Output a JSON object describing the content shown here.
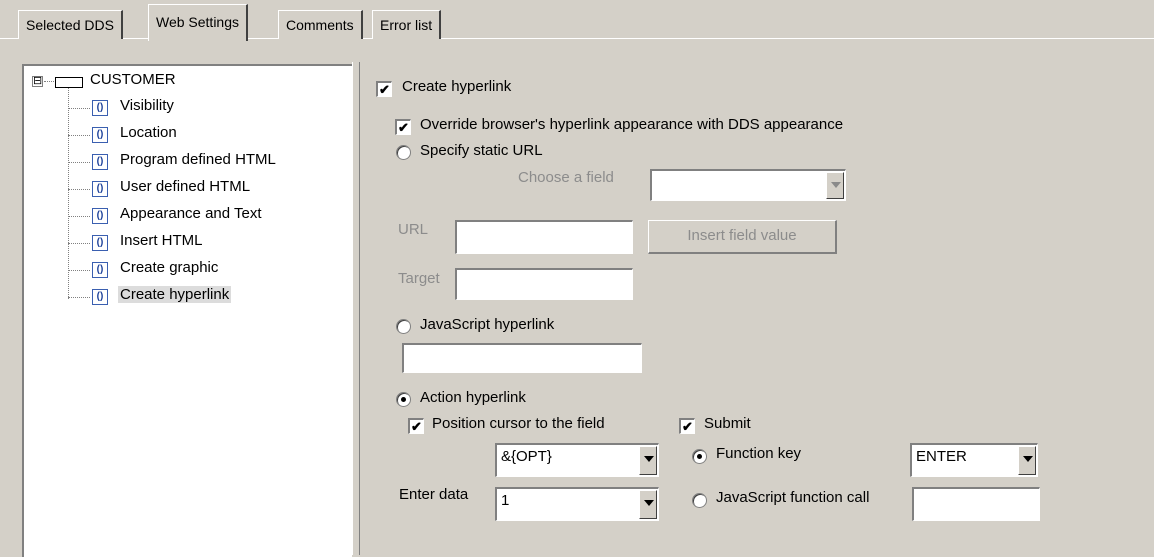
{
  "tabs": [
    {
      "label": "Selected DDS",
      "active": false
    },
    {
      "label": "Web Settings",
      "active": true
    },
    {
      "label": "Comments",
      "active": false
    },
    {
      "label": "Error list",
      "active": false
    }
  ],
  "tree": {
    "root": {
      "label": "CUSTOMER",
      "expander": "⊟",
      "icon": "record-icon"
    },
    "items": [
      {
        "label": "Visibility",
        "icon": "field-icon"
      },
      {
        "label": "Location",
        "icon": "field-icon"
      },
      {
        "label": "Program defined HTML",
        "icon": "field-icon"
      },
      {
        "label": "User defined HTML",
        "icon": "field-icon"
      },
      {
        "label": "Appearance and Text",
        "icon": "field-icon"
      },
      {
        "label": "Insert HTML",
        "icon": "field-icon"
      },
      {
        "label": "Create graphic",
        "icon": "field-icon"
      },
      {
        "label": "Create hyperlink",
        "icon": "field-icon",
        "selected": true
      }
    ]
  },
  "form": {
    "create_hyperlink": {
      "label": "Create hyperlink",
      "checked": true
    },
    "override_appearance": {
      "label": "Override browser's hyperlink appearance with DDS appearance",
      "checked": true
    },
    "static_url": {
      "label": "Specify static URL",
      "selected": false,
      "choose_field_label": "Choose a field",
      "choose_field_value": "",
      "url_label": "URL",
      "url_value": "",
      "insert_button": "Insert field value",
      "target_label": "Target",
      "target_value": ""
    },
    "javascript_hyperlink": {
      "label": "JavaScript hyperlink",
      "selected": false,
      "value": ""
    },
    "action_hyperlink": {
      "label": "Action hyperlink",
      "selected": true,
      "position_cursor": {
        "label": "Position cursor to the field",
        "checked": true
      },
      "field_value": "&{OPT}",
      "enter_data_label": "Enter data",
      "enter_data_value": "1",
      "submit": {
        "label": "Submit",
        "checked": true
      },
      "function_key": {
        "label": "Function key",
        "selected": true,
        "value": "ENTER"
      },
      "js_function_call": {
        "label": "JavaScript function call",
        "selected": false,
        "value": ""
      }
    }
  },
  "glyphs": {
    "check": "✔",
    "expander": "⊟",
    "field_icon_text": "()"
  }
}
